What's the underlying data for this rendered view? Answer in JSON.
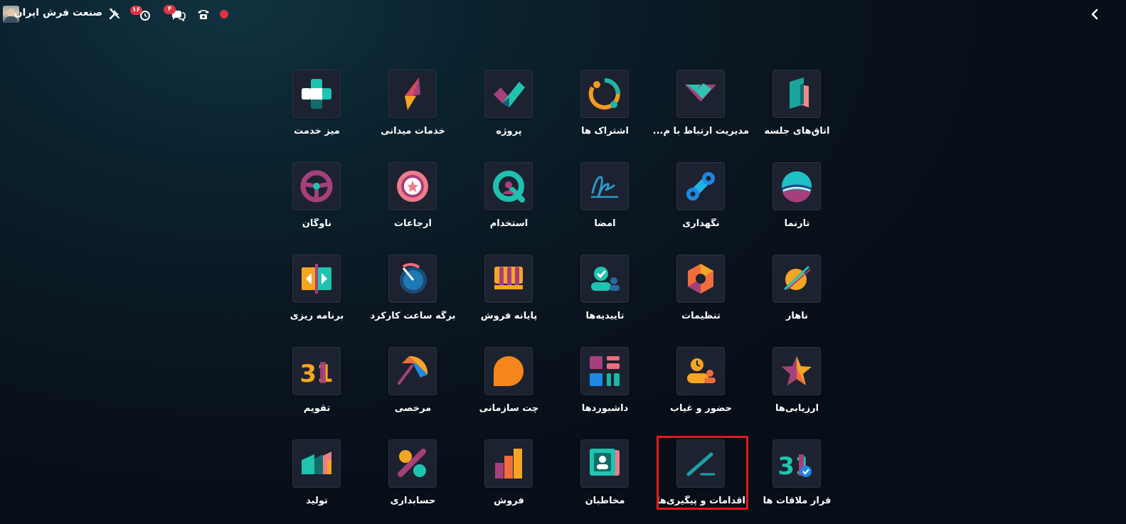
{
  "topbar": {
    "company_name": "صنعت فرش ایران",
    "activity_count": "۱۶",
    "message_count": "۴",
    "icons": [
      "avatar",
      "tools-icon",
      "activity-clock-icon",
      "chat-icon",
      "phone-icon",
      "record-dot",
      "chevron-left-icon"
    ],
    "colors": {
      "badge": "#dc3545",
      "record": "#e0333f"
    }
  },
  "apps": [
    {
      "label": "اتاق‌های جلسه",
      "icon": "meeting-rooms-icon"
    },
    {
      "label": "مدیریت ارتباط با م...",
      "icon": "crm-icon"
    },
    {
      "label": "اشتراک ها",
      "icon": "subscriptions-icon"
    },
    {
      "label": "پروژه",
      "icon": "project-icon"
    },
    {
      "label": "خدمات میدانی",
      "icon": "field-service-icon"
    },
    {
      "label": "میز خدمت",
      "icon": "helpdesk-icon"
    },
    {
      "label": "تارنما",
      "icon": "website-icon"
    },
    {
      "label": "نگهداری",
      "icon": "maintenance-icon"
    },
    {
      "label": "امضا",
      "icon": "sign-icon"
    },
    {
      "label": "استخدام",
      "icon": "recruitment-icon"
    },
    {
      "label": "ارجاعات",
      "icon": "referrals-icon"
    },
    {
      "label": "ناوگان",
      "icon": "fleet-icon"
    },
    {
      "label": "ناهار",
      "icon": "lunch-icon"
    },
    {
      "label": "تنظیمات",
      "icon": "settings-icon"
    },
    {
      "label": "تاییدیه‌ها",
      "icon": "approvals-icon"
    },
    {
      "label": "پایانه فروش",
      "icon": "point-of-sale-icon"
    },
    {
      "label": "برگه ساعت کارکرد",
      "icon": "timesheets-icon"
    },
    {
      "label": "برنامه ریزی",
      "icon": "planning-icon"
    },
    {
      "label": "ارزیابی‌ها",
      "icon": "appraisals-icon"
    },
    {
      "label": "حضور و غیاب",
      "icon": "attendances-icon"
    },
    {
      "label": "داشبوردها",
      "icon": "dashboards-icon"
    },
    {
      "label": "چت سازمانی",
      "icon": "discuss-icon"
    },
    {
      "label": "مرخصی",
      "icon": "time-off-icon"
    },
    {
      "label": "تقویم",
      "icon": "calendar-icon"
    },
    {
      "label": "قرار ملاقات ها",
      "icon": "appointments-icon"
    },
    {
      "label": "اقدامات و پیگیری‌ها",
      "icon": "activities-icon",
      "highlighted": true
    },
    {
      "label": "مخاطبان",
      "icon": "contacts-icon"
    },
    {
      "label": "فروش",
      "icon": "sales-icon"
    },
    {
      "label": "حسابداری",
      "icon": "accounting-icon"
    },
    {
      "label": "تولید",
      "icon": "manufacturing-icon"
    }
  ],
  "colors": {
    "tile_background": "#1d2230",
    "highlight_border": "#e3161e"
  }
}
